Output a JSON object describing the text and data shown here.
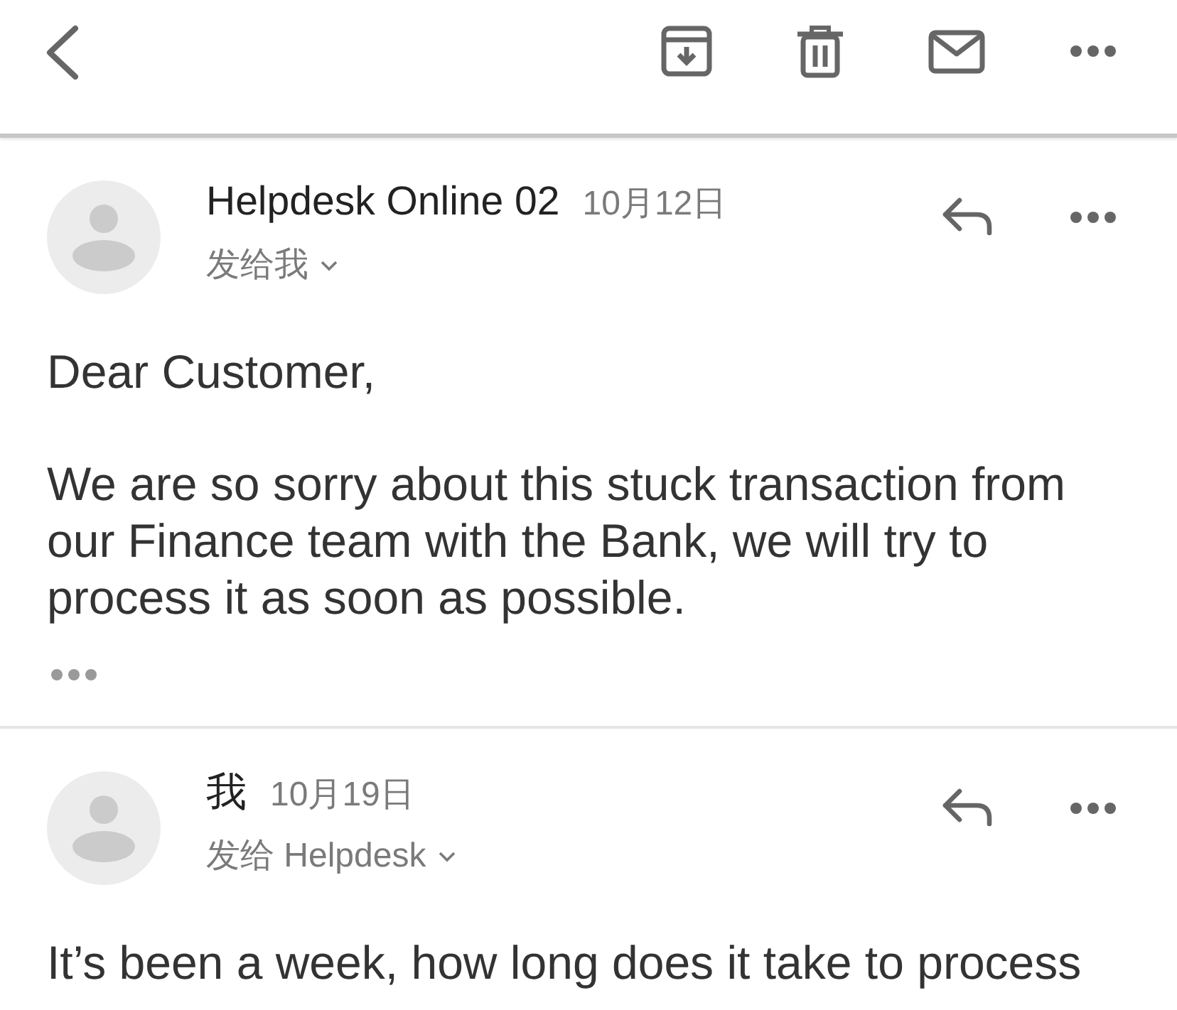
{
  "messages": [
    {
      "sender": "Helpdesk Online 02",
      "date": "10月12日",
      "recipient": "发给我",
      "body": [
        "Dear Customer,",
        "We are so sorry about this stuck transaction from our Finance team with the Bank, we will try to process it as soon as possible."
      ],
      "trimmed_content": true
    },
    {
      "sender": "我",
      "date": "10月19日",
      "recipient": "发给 Helpdesk",
      "body": [
        "It’s been a week, how long does it take to process"
      ],
      "trimmed_content": false
    }
  ]
}
